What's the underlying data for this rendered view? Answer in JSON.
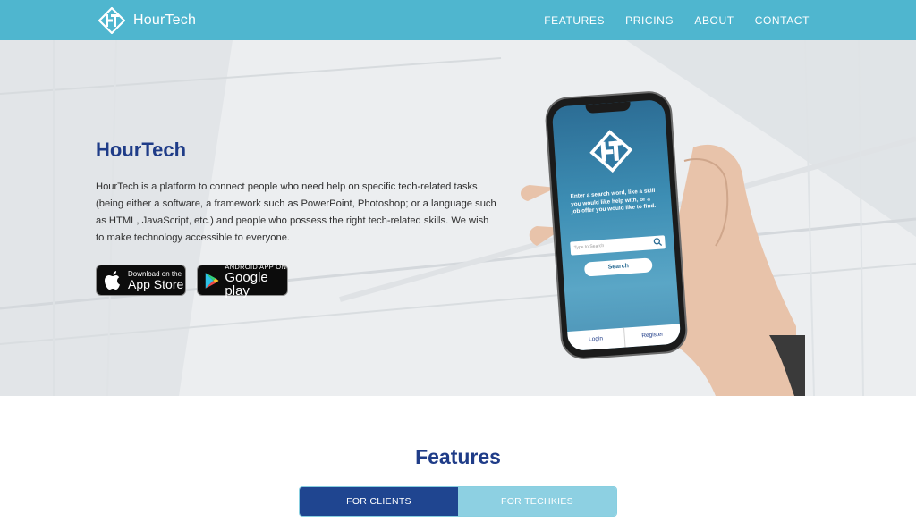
{
  "brand": {
    "name": "HourTech",
    "logo_icon": "ht-logo-icon"
  },
  "nav": {
    "items": [
      {
        "label": "FEATURES"
      },
      {
        "label": "PRICING"
      },
      {
        "label": "ABOUT"
      },
      {
        "label": "CONTACT"
      }
    ]
  },
  "hero": {
    "title": "HourTech",
    "description": "HourTech is a platform to connect people who need help on specific tech-related tasks (being either a software, a framework such as PowerPoint, Photoshop; or a language such as HTML, JavaScript, etc.) and people who possess the right tech-related skills. We wish to make technology accessible to everyone.",
    "app_store": {
      "small": "Download on the",
      "big": "App Store",
      "icon": "apple-icon"
    },
    "google_play": {
      "small": "ANDROID APP ON",
      "big": "Google play",
      "icon": "google-play-icon"
    }
  },
  "phone_app": {
    "prompt": "Enter a search word, like a skill you would like help with, or a job offer you would like to find.",
    "search_placeholder": "Type to Search",
    "search_button": "Search",
    "tabs": [
      "Login",
      "Register"
    ]
  },
  "features": {
    "title": "Features",
    "tabs": [
      {
        "label": "FOR CLIENTS",
        "active": true
      },
      {
        "label": "FOR TECHKIES",
        "active": false
      }
    ]
  },
  "colors": {
    "navbar": "#4fb6cf",
    "heading": "#1f3c88",
    "tab_active": "#1f4590",
    "tab_inactive": "#8dd0e2"
  }
}
